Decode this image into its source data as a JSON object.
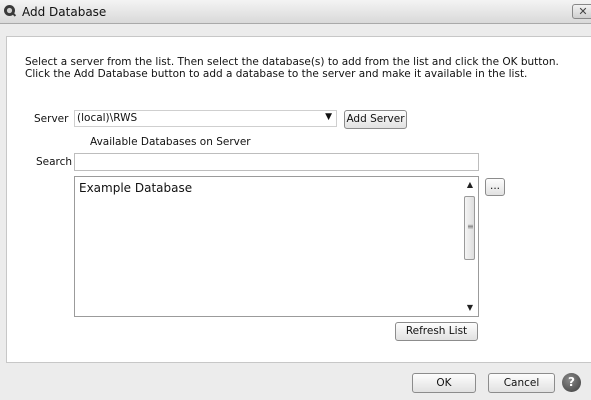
{
  "window": {
    "title": "Add Database",
    "close_glyph": "✕"
  },
  "instructions": "Select a server from the list.  Then select the database(s) to add from the list and click the OK button.  Click the Add Database button to add a database to the server and make it available in the list.",
  "server": {
    "label": "Server",
    "value": "(local)\\RWS",
    "add_button": "Add Server"
  },
  "available_label": "Available Databases on Server",
  "search": {
    "label": "Search",
    "value": "",
    "placeholder": ""
  },
  "databases": [
    "Example Database"
  ],
  "browse_button": "...",
  "refresh_button": "Refresh List",
  "ok_button": "OK",
  "cancel_button": "Cancel",
  "help_glyph": "?",
  "scroll_grip": "≡",
  "icons": {
    "app": "magnifier-logo-icon",
    "close": "close-icon",
    "dropdown": "chevron-down-icon",
    "scroll_up": "scroll-up-icon",
    "scroll_down": "scroll-down-icon",
    "help": "help-icon"
  }
}
